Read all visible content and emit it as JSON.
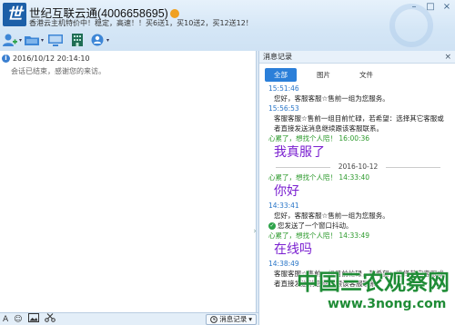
{
  "header": {
    "title": "世纪互联云通(4006658695)",
    "subtitle": "香港云主机特价中！稳定，高速！！买6送1，买10送2，买12送12！",
    "window_buttons": {
      "minimize": "–",
      "maximize": "□",
      "close": "×"
    }
  },
  "toolbar": {
    "icons": [
      "add-contact-icon",
      "folder-icon",
      "screen-icon",
      "building-icon",
      "user-status-icon"
    ]
  },
  "left_panel": {
    "timestamp": "2016/10/12 20:14:10",
    "message": "会话已结束，感谢您的来访。"
  },
  "bottom_bar": {
    "font_icon": "A",
    "emoji_icon": "☺",
    "history_label": "消息记录"
  },
  "right_panel": {
    "title": "消息记录",
    "tabs": [
      "全部",
      "图片",
      "文件"
    ],
    "entries": [
      {
        "time": "15:51:46",
        "text": "您好，客服客服☆售前一组为您服务。"
      },
      {
        "time": "15:56:53",
        "text": "客服客服☆售前一组目前忙碌，若希望：选择其它客服或者直接发送消息继续跟该客服联系。"
      },
      {
        "sender": "心累了，想找个人陪！",
        "time": "16:00:36",
        "text": "我真服了"
      },
      {
        "date": "2016-10-12"
      },
      {
        "sender": "心累了，想找个人陪！",
        "time": "14:33:40",
        "text": "你好"
      },
      {
        "time": "14:33:41",
        "text": "您好，客服客服☆售前一组为您服务。"
      },
      {
        "notice": "您发送了一个窗口抖动。"
      },
      {
        "sender": "心累了，想找个人陪！",
        "time": "14:33:49",
        "text": "在线吗"
      },
      {
        "time": "14:38:49",
        "text": "客服客服☆售前一组目前忙碌，若希望：选择其它客服或者直接发送消息继续跟该客服联系。"
      }
    ]
  },
  "watermark": {
    "text": "中国三农观察网",
    "url": "www.3nong.com"
  }
}
